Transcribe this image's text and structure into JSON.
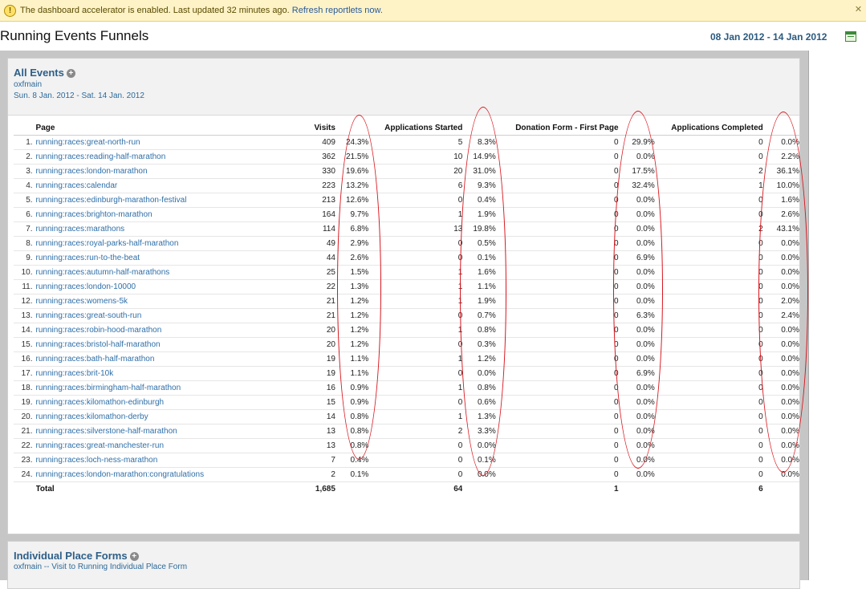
{
  "notice": {
    "icon": "warning-icon",
    "message": "The dashboard accelerator is enabled. Last updated 32 minutes ago.",
    "refresh_link": "Refresh reportlets now.",
    "close_icon": "close-icon"
  },
  "header": {
    "title": "Running Events Funnels",
    "date_range": "08 Jan 2012 - 14 Jan 2012",
    "calendar_icon": "calendar-icon"
  },
  "report": {
    "title": "All Events",
    "add_icon": "plus-icon",
    "account": "oxfmain",
    "period": "Sun. 8 Jan. 2012 - Sat. 14 Jan. 2012",
    "columns": [
      "Page",
      "Visits",
      "Applications Started",
      "Donation Form - First Page",
      "Applications Completed"
    ],
    "rows": [
      [
        "1.",
        "running:races:great-north-run",
        "409",
        "24.3%",
        "5",
        "8.3%",
        "0",
        "29.9%",
        "0",
        "0.0%"
      ],
      [
        "2.",
        "running:races:reading-half-marathon",
        "362",
        "21.5%",
        "10",
        "14.9%",
        "0",
        "0.0%",
        "0",
        "2.2%"
      ],
      [
        "3.",
        "running:races:london-marathon",
        "330",
        "19.6%",
        "20",
        "31.0%",
        "0",
        "17.5%",
        "2",
        "36.1%"
      ],
      [
        "4.",
        "running:races:calendar",
        "223",
        "13.2%",
        "6",
        "9.3%",
        "0",
        "32.4%",
        "1",
        "10.0%"
      ],
      [
        "5.",
        "running:races:edinburgh-marathon-festival",
        "213",
        "12.6%",
        "0",
        "0.4%",
        "0",
        "0.0%",
        "0",
        "1.6%"
      ],
      [
        "6.",
        "running:races:brighton-marathon",
        "164",
        "9.7%",
        "1",
        "1.9%",
        "0",
        "0.0%",
        "0",
        "2.6%"
      ],
      [
        "7.",
        "running:races:marathons",
        "114",
        "6.8%",
        "13",
        "19.8%",
        "0",
        "0.0%",
        "2",
        "43.1%"
      ],
      [
        "8.",
        "running:races:royal-parks-half-marathon",
        "49",
        "2.9%",
        "0",
        "0.5%",
        "0",
        "0.0%",
        "0",
        "0.0%"
      ],
      [
        "9.",
        "running:races:run-to-the-beat",
        "44",
        "2.6%",
        "0",
        "0.1%",
        "0",
        "6.9%",
        "0",
        "0.0%"
      ],
      [
        "10.",
        "running:races:autumn-half-marathons",
        "25",
        "1.5%",
        "1",
        "1.6%",
        "0",
        "0.0%",
        "0",
        "0.0%"
      ],
      [
        "11.",
        "running:races:london-10000",
        "22",
        "1.3%",
        "1",
        "1.1%",
        "0",
        "0.0%",
        "0",
        "0.0%"
      ],
      [
        "12.",
        "running:races:womens-5k",
        "21",
        "1.2%",
        "1",
        "1.9%",
        "0",
        "0.0%",
        "0",
        "2.0%"
      ],
      [
        "13.",
        "running:races:great-south-run",
        "21",
        "1.2%",
        "0",
        "0.7%",
        "0",
        "6.3%",
        "0",
        "2.4%"
      ],
      [
        "14.",
        "running:races:robin-hood-marathon",
        "20",
        "1.2%",
        "1",
        "0.8%",
        "0",
        "0.0%",
        "0",
        "0.0%"
      ],
      [
        "15.",
        "running:races:bristol-half-marathon",
        "20",
        "1.2%",
        "0",
        "0.3%",
        "0",
        "0.0%",
        "0",
        "0.0%"
      ],
      [
        "16.",
        "running:races:bath-half-marathon",
        "19",
        "1.1%",
        "1",
        "1.2%",
        "0",
        "0.0%",
        "0",
        "0.0%"
      ],
      [
        "17.",
        "running:races:brit-10k",
        "19",
        "1.1%",
        "0",
        "0.0%",
        "0",
        "6.9%",
        "0",
        "0.0%"
      ],
      [
        "18.",
        "running:races:birmingham-half-marathon",
        "16",
        "0.9%",
        "1",
        "0.8%",
        "0",
        "0.0%",
        "0",
        "0.0%"
      ],
      [
        "19.",
        "running:races:kilomathon-edinburgh",
        "15",
        "0.9%",
        "0",
        "0.6%",
        "0",
        "0.0%",
        "0",
        "0.0%"
      ],
      [
        "20.",
        "running:races:kilomathon-derby",
        "14",
        "0.8%",
        "1",
        "1.3%",
        "0",
        "0.0%",
        "0",
        "0.0%"
      ],
      [
        "21.",
        "running:races:silverstone-half-marathon",
        "13",
        "0.8%",
        "2",
        "3.3%",
        "0",
        "0.0%",
        "0",
        "0.0%"
      ],
      [
        "22.",
        "running:races:great-manchester-run",
        "13",
        "0.8%",
        "0",
        "0.0%",
        "0",
        "0.0%",
        "0",
        "0.0%"
      ],
      [
        "23.",
        "running:races:loch-ness-marathon",
        "7",
        "0.4%",
        "0",
        "0.1%",
        "0",
        "0.0%",
        "0",
        "0.0%"
      ],
      [
        "24.",
        "running:races:london-marathon:congratulations",
        "2",
        "0.1%",
        "0",
        "0.0%",
        "0",
        "0.0%",
        "0",
        "0.0%"
      ]
    ],
    "total": {
      "label": "Total",
      "visits": "1,685",
      "started": "64",
      "donation": "1",
      "completed": "6"
    }
  },
  "next_report": {
    "title": "Individual Place Forms",
    "add_icon": "plus-icon",
    "subtitle": "oxfmain -- Visit to Running Individual Place Form"
  },
  "colors": {
    "annotation": "#d8141c",
    "link": "#2f6fa8",
    "notice_bg": "#fdf3c7"
  }
}
